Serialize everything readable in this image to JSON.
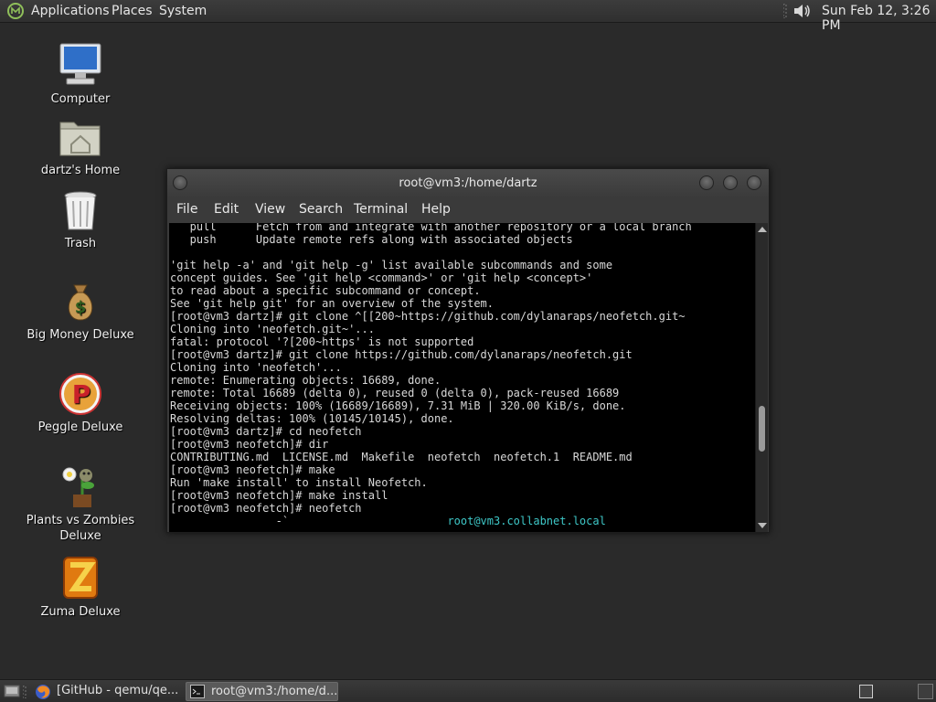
{
  "top_panel": {
    "menus": [
      "Applications",
      "Places",
      "System"
    ],
    "clock": "Sun Feb 12,  3:26 PM"
  },
  "desktop_icons": [
    {
      "label": "Computer",
      "icon": "computer-icon"
    },
    {
      "label": "dartz's Home",
      "icon": "home-folder-icon"
    },
    {
      "label": "Trash",
      "icon": "trash-icon"
    },
    {
      "label": "Big Money Deluxe",
      "icon": "money-bag-icon"
    },
    {
      "label": "Peggle Deluxe",
      "icon": "peggle-icon"
    },
    {
      "label": "Plants vs Zombies\nDeluxe",
      "icon": "plants-vs-zombies-icon"
    },
    {
      "label": "Zuma Deluxe",
      "icon": "zuma-icon"
    }
  ],
  "terminal": {
    "title": "root@vm3:/home/dartz",
    "menu": [
      "File",
      "Edit",
      "View",
      "Search",
      "Terminal",
      "Help"
    ],
    "lines": [
      "   pull      Fetch from and integrate with another repository or a local branch",
      "   push      Update remote refs along with associated objects",
      "",
      "'git help -a' and 'git help -g' list available subcommands and some",
      "concept guides. See 'git help <command>' or 'git help <concept>'",
      "to read about a specific subcommand or concept.",
      "See 'git help git' for an overview of the system.",
      "[root@vm3 dartz]# git clone ^[[200~https://github.com/dylanaraps/neofetch.git~",
      "Cloning into 'neofetch.git~'...",
      "fatal: protocol '?[200~https' is not supported",
      "[root@vm3 dartz]# git clone https://github.com/dylanaraps/neofetch.git",
      "Cloning into 'neofetch'...",
      "remote: Enumerating objects: 16689, done.",
      "remote: Total 16689 (delta 0), reused 0 (delta 0), pack-reused 16689",
      "Receiving objects: 100% (16689/16689), 7.31 MiB | 320.00 KiB/s, done.",
      "Resolving deltas: 100% (10145/10145), done.",
      "[root@vm3 dartz]# cd neofetch",
      "[root@vm3 neofetch]# dir",
      "CONTRIBUTING.md  LICENSE.md  Makefile  neofetch  neofetch.1  README.md",
      "[root@vm3 neofetch]# make",
      "Run 'make install' to install Neofetch.",
      "[root@vm3 neofetch]# make install",
      "[root@vm3 neofetch]# neofetch",
      "                -`                        root@vm3.collabnet.local"
    ],
    "host_color": "#3ec7c7"
  },
  "taskbar": {
    "tasks": [
      {
        "label": "[GitHub - qemu/qe...",
        "icon": "firefox-icon",
        "active": false
      },
      {
        "label": "root@vm3:/home/d...",
        "icon": "terminal-icon",
        "active": true
      }
    ]
  }
}
